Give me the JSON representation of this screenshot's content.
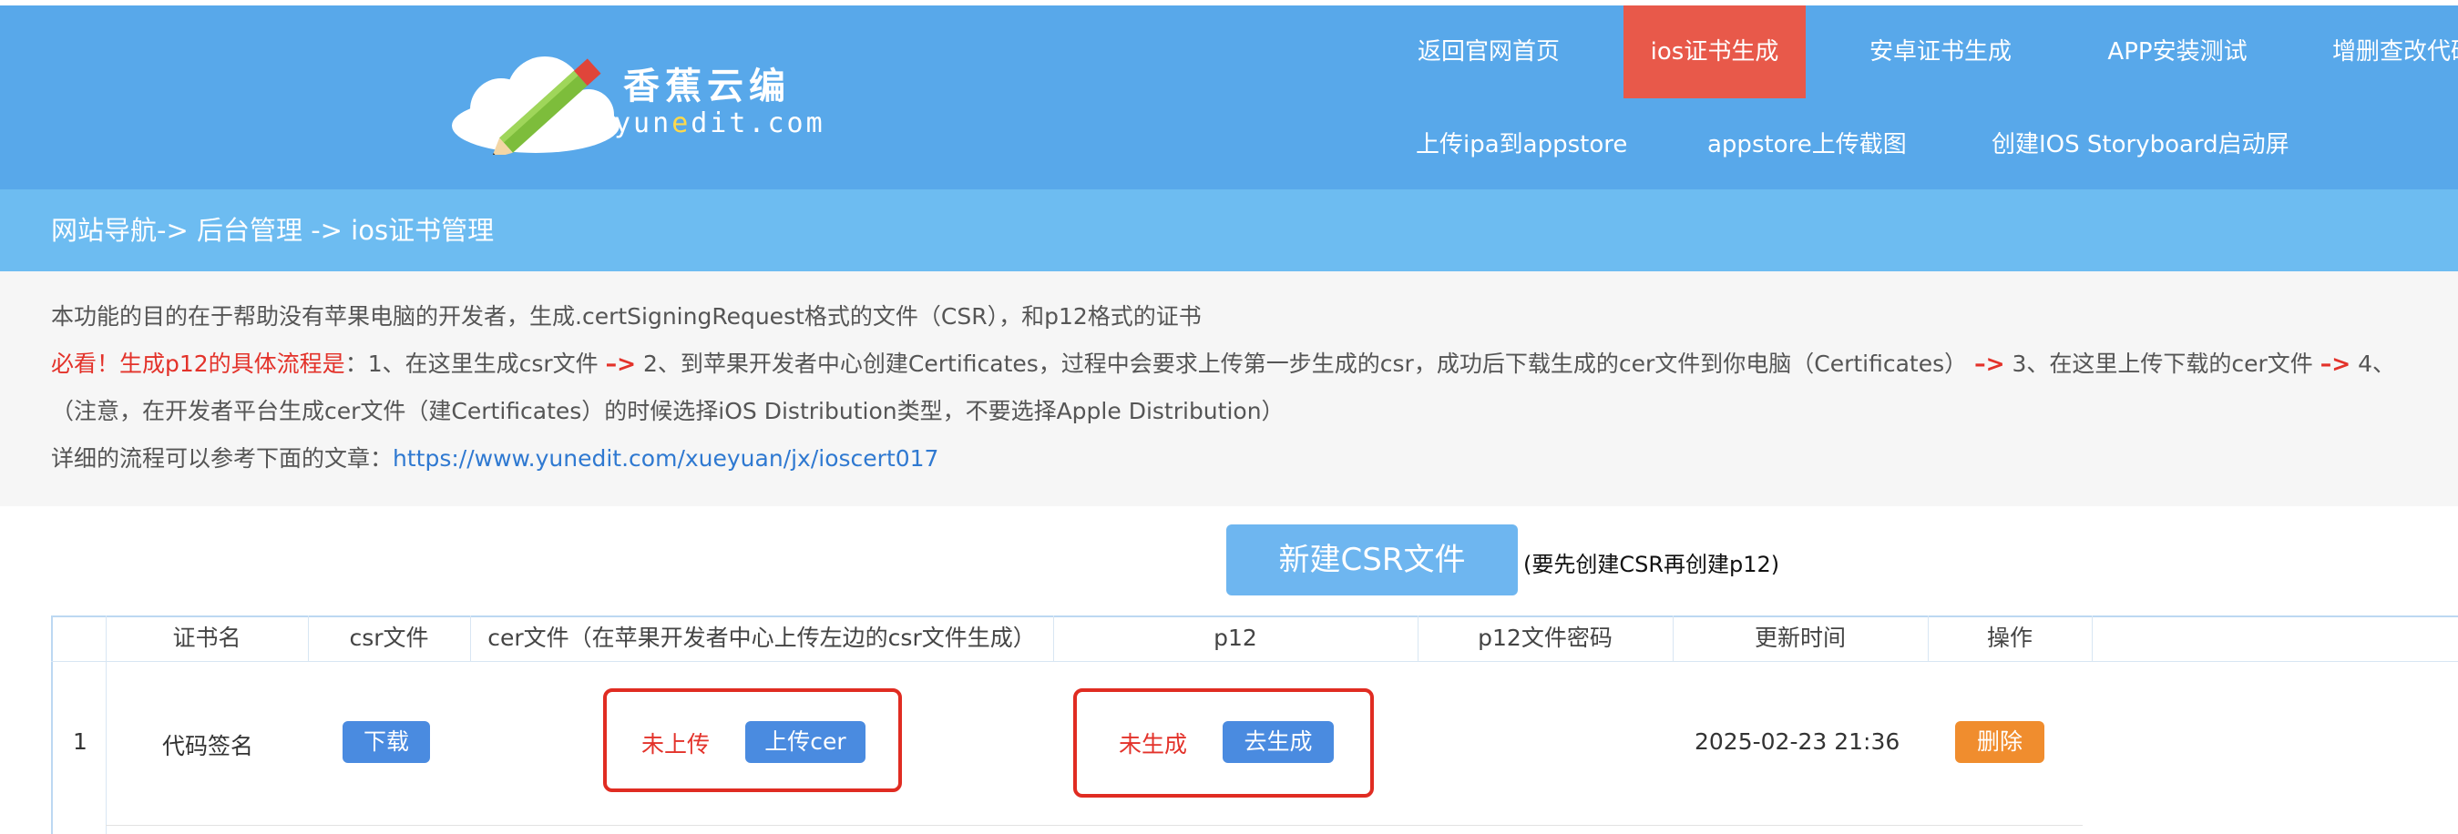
{
  "header": {
    "brand_cn": "香蕉云编",
    "brand_en_prefix": "yun",
    "brand_en_e": "e",
    "brand_en_suffix": "dit.com",
    "nav_row1": [
      "返回官网首页",
      "ios证书生成",
      "安卓证书生成",
      "APP安装测试",
      "增删查改代码"
    ],
    "nav_row2": [
      "上传ipa到appstore",
      "appstore上传截图",
      "创建IOS Storyboard启动屏"
    ],
    "active_color": "#e8594a",
    "bg_color": "#58a8ea"
  },
  "breadcrumb": "网站导航-> 后台管理 -> ios证书管理",
  "info": {
    "line1": "本功能的目的在于帮助没有苹果电脑的开发者，生成.certSigningRequest格式的文件（CSR），和p12格式的证书",
    "line2_lead": "必看！生成p12的具体流程是",
    "line2_a": "：1、在这里生成csr文件 ",
    "arrow": "–>",
    "line2_b": " 2、到苹果开发者中心创建Certificates，过程中会要求上传第一步生成的csr，成功后下载生成的cer文件到你电脑（Certificates） ",
    "line2_c": " 3、在这里上传下载的cer文件 ",
    "line2_d": " 4、",
    "line3": "（注意，在开发者平台生成cer文件（建Certificates）的时候选择iOS Distribution类型，不要选择Apple Distribution）",
    "line4_text": "详细的流程可以参考下面的文章：",
    "line4_link": "https://www.yunedit.com/xueyuan/jx/ioscert017"
  },
  "csr": {
    "button_label": "新建CSR文件",
    "note": "(要先创建CSR再创建p12)"
  },
  "table": {
    "headers": [
      "证书名",
      "csr文件",
      "cer文件（在苹果开发者中心上传左边的csr文件生成）",
      "p12",
      "p12文件密码",
      "更新时间",
      "操作"
    ],
    "rows": [
      {
        "index": "1",
        "name": "代码签名",
        "csr_button": "下载",
        "cer_status": "未上传",
        "cer_button": "上传cer",
        "p12_status": "未生成",
        "p12_button": "去生成",
        "password": "",
        "updated": "2025-02-23 21:36",
        "action_button": "删除"
      }
    ]
  }
}
